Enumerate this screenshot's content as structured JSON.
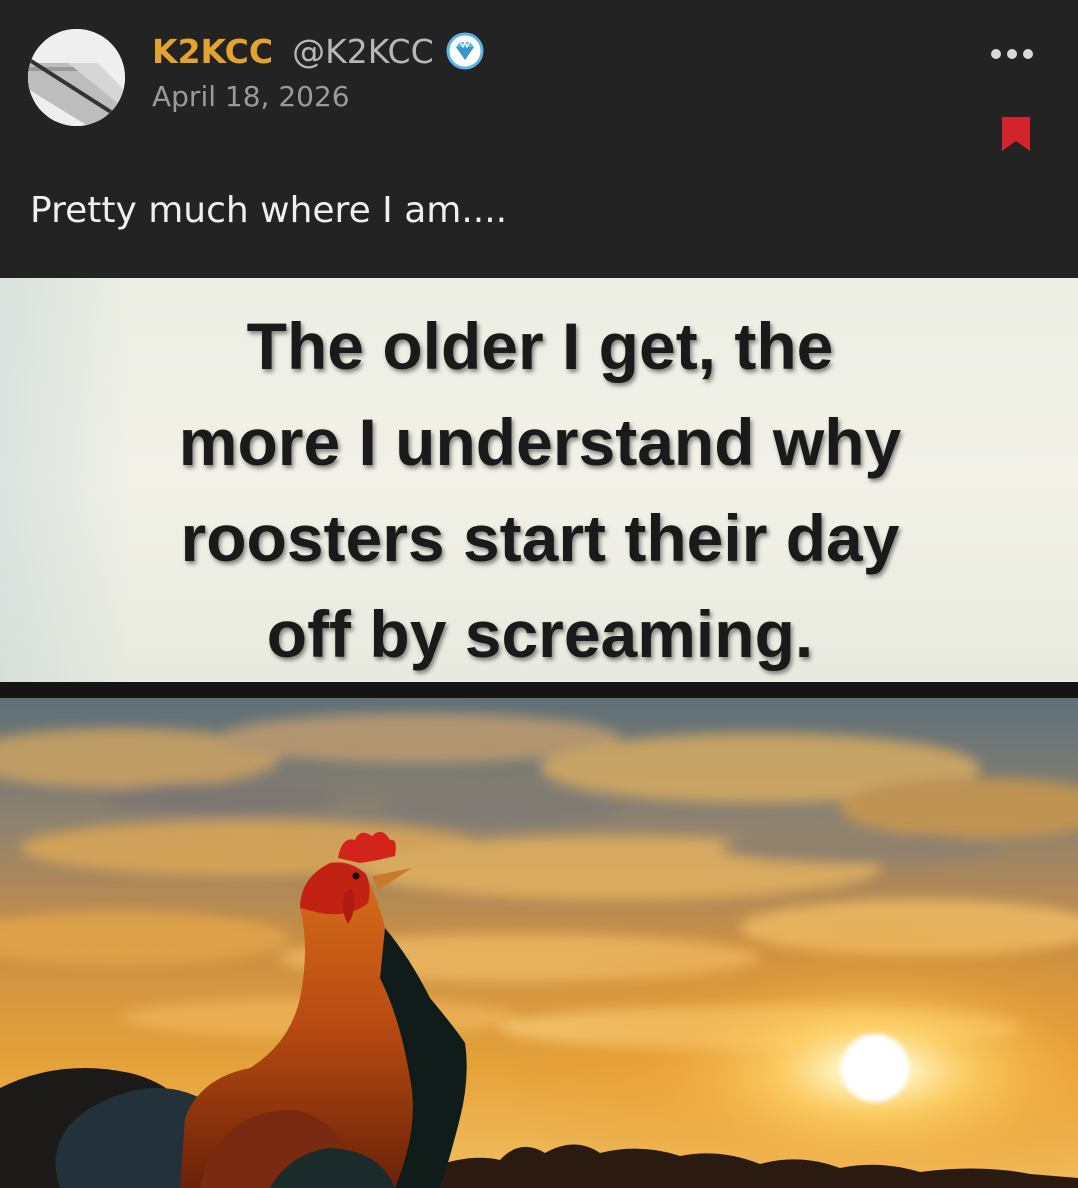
{
  "post": {
    "author": {
      "display_name": "K2KCC",
      "handle": "@K2KCC",
      "avatar_icon": "avatar-diagonal-logo",
      "verified_icon": "diamond-badge-icon"
    },
    "date": "April 18, 2026",
    "text": "Pretty much where I am....",
    "menu_icon": "more-dots-icon",
    "bookmark_icon": "bookmark-icon",
    "media": {
      "caption_lines": [
        "The older I get, the",
        "more I understand why",
        "roosters start their day",
        "off by screaming."
      ],
      "scene_icon": "rooster-sunrise-photo"
    }
  },
  "colors": {
    "background": "#232323",
    "display_name": "#e2a42c",
    "handle": "#b7b7b7",
    "date": "#9a9a9a",
    "post_text": "#efefef",
    "bookmark": "#d3242e",
    "verified_badge": "#5ab6e8"
  }
}
